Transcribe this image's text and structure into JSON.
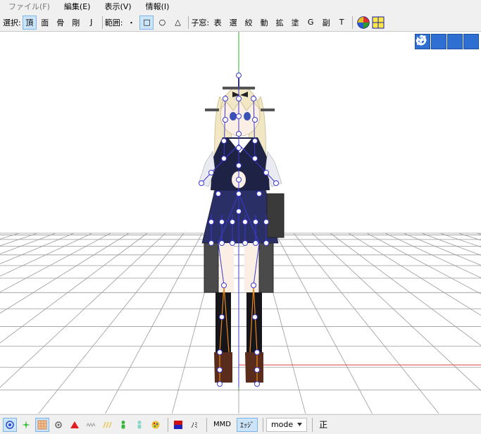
{
  "menubar": {
    "items": [
      {
        "label": "ファイル(F)",
        "disabled": true
      },
      {
        "label": "編集(E)",
        "disabled": false
      },
      {
        "label": "表示(V)",
        "disabled": false
      },
      {
        "label": "情報(I)",
        "disabled": false
      }
    ]
  },
  "toolbar": {
    "select_label": "選択:",
    "select_buttons": [
      {
        "label": "頂",
        "active": true
      },
      {
        "label": "面",
        "active": false
      },
      {
        "label": "骨",
        "active": false
      },
      {
        "label": "剛",
        "active": false
      },
      {
        "label": "J",
        "active": false
      }
    ],
    "range_label": "範囲:",
    "range_buttons": [
      {
        "label": "・",
        "active": false
      },
      {
        "label": "□",
        "active": true
      },
      {
        "label": "○",
        "active": false
      },
      {
        "label": "△",
        "active": false
      }
    ],
    "child_window_label": "子窓:",
    "child_buttons": [
      "表",
      "選",
      "絞",
      "動",
      "拡",
      "塗",
      "G",
      "副",
      "T"
    ],
    "icons": [
      "color-wheel-icon",
      "grid-quad-icon"
    ]
  },
  "viewport": {
    "tools": [
      "move-arrows-icon",
      "move-cross-icon",
      "bone-move-icon",
      "rotate-icon"
    ],
    "colors": {
      "background": "#ffffff",
      "grid": "#9a9a9a",
      "axis_x": "#e04040",
      "axis_y": "#3aa83a",
      "bone": "#3a3ad0",
      "bone_orange": "#e88a1a"
    }
  },
  "bottombar": {
    "icons": [
      "point-icon",
      "sparkle-icon",
      "grid-pattern-icon",
      "dot-icon",
      "triangle-red-icon",
      "wave-icon",
      "dash-icon",
      "figure-green-icon",
      "figure-teal-icon",
      "palette-icon",
      "color-swatch-icon"
    ],
    "nomi_label": "ﾉﾐ",
    "mmd_label": "MMD",
    "edge_label": "ｴｯｼﾞ",
    "mode_label": "mode",
    "sei_label": "正"
  }
}
